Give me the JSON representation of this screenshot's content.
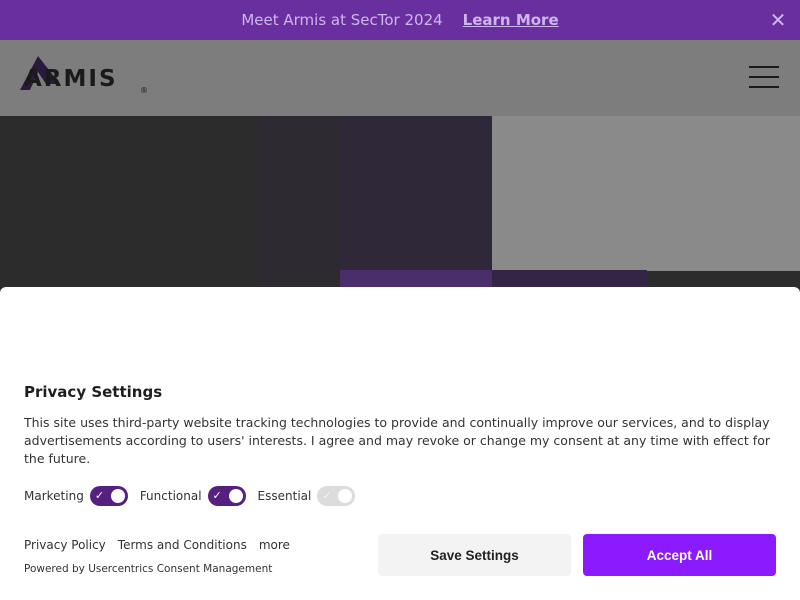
{
  "announcement": {
    "message": "Meet Armis at SecTor 2024",
    "link_label": "Learn More",
    "close_glyph": "✕"
  },
  "header": {
    "logo_text": "ARMIS",
    "logo_mark": "®",
    "menu_icon": "hamburger-icon"
  },
  "consent": {
    "title": "Privacy Settings",
    "description": "This site uses third-party website tracking technologies to provide and continually improve our services, and to display advertisements according to users' interests. I agree and may revoke or change my consent at any time with effect for the future.",
    "toggles": [
      {
        "label": "Marketing",
        "state": "on"
      },
      {
        "label": "Functional",
        "state": "on"
      },
      {
        "label": "Essential",
        "state": "disabled-on"
      }
    ],
    "links": [
      "Privacy Policy",
      "Terms and Conditions",
      "more"
    ],
    "powered_by": "Powered by Usercentrics Consent Management",
    "save_label": "Save Settings",
    "accept_label": "Accept All"
  },
  "colors": {
    "announce_bg": "#6a2f9e",
    "toggle_on": "#55207f",
    "accept_bg": "#8c1aff"
  }
}
